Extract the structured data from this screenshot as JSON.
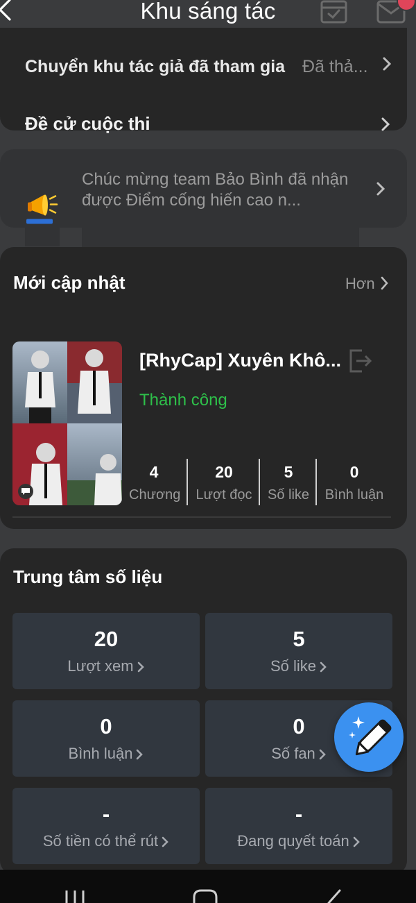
{
  "header": {
    "title": "Khu sáng tác"
  },
  "top_section": {
    "partial_row_label": "Chuyển khu tác giả đã tham gia",
    "partial_row_value": "Đã thả...",
    "nominate_label": "Đề cử cuộc thi"
  },
  "notice": {
    "text": "Chúc mừng team Bảo Bình đã nhận được Điểm cống hiến cao n..."
  },
  "recent": {
    "title": "Mới cập nhật",
    "more_label": "Hơn",
    "work": {
      "title": "[RhyCap] Xuyên Khô...",
      "status": "Thành công",
      "stats": [
        {
          "value": "4",
          "label": "Chương"
        },
        {
          "value": "20",
          "label": "Lượt đọc"
        },
        {
          "value": "5",
          "label": "Số like"
        },
        {
          "value": "0",
          "label": "Bình luận"
        }
      ]
    }
  },
  "data_center": {
    "title": "Trung tâm số liệu",
    "tiles": [
      {
        "value": "20",
        "label": "Lượt xem"
      },
      {
        "value": "5",
        "label": "Số like"
      },
      {
        "value": "0",
        "label": "Bình luận"
      },
      {
        "value": "0",
        "label": "Số fan"
      },
      {
        "value": "-",
        "label": "Số tiền có thể rút"
      },
      {
        "value": "-",
        "label": "Đang quyết toán"
      }
    ]
  },
  "icons": {
    "back": "chevron-left-icon",
    "calendar": "calendar-check-icon",
    "mail": "mail-icon",
    "notice": "megaphone-icon",
    "exit": "exit-icon",
    "fab": "pencil-sparkle-icon",
    "nav": [
      "recent-apps-icon",
      "home-icon",
      "back-icon"
    ]
  },
  "colors": {
    "status_success": "#2ec04a",
    "fab": "#3b91f0",
    "badge": "#e0455a"
  }
}
